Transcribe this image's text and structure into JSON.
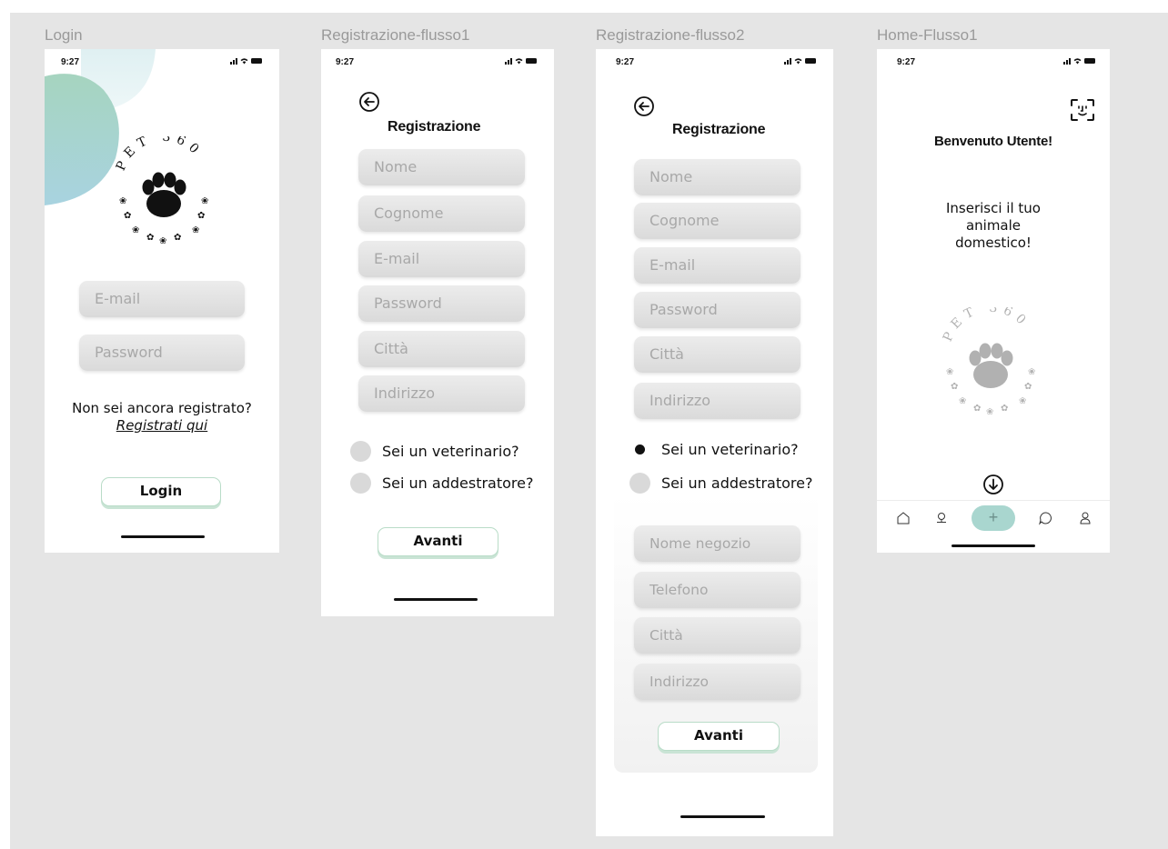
{
  "frames": {
    "login": {
      "label": "Login",
      "time": "9:27",
      "logo_text": "PET 360",
      "email_placeholder": "E-mail",
      "password_placeholder": "Password",
      "not_registered": "Non sei ancora registrato?",
      "register_link": "Registrati qui",
      "login_button": "Login"
    },
    "reg1": {
      "label": "Registrazione-flusso1",
      "time": "9:27",
      "title": "Registrazione",
      "fields": [
        "Nome",
        "Cognome",
        "E-mail",
        "Password",
        "Città",
        "Indirizzo"
      ],
      "vet_question": "Sei un veterinario?",
      "trainer_question": "Sei un addestratore?",
      "next_button": "Avanti"
    },
    "reg2": {
      "label": "Registrazione-flusso2",
      "time": "9:27",
      "title": "Registrazione",
      "fields": [
        "Nome",
        "Cognome",
        "E-mail",
        "Password",
        "Città",
        "Indirizzo"
      ],
      "vet_question": "Sei un veterinario?",
      "vet_checked": true,
      "trainer_question": "Sei un addestratore?",
      "shop_fields": [
        "Nome negozio",
        "Telefono",
        "Città",
        "Indirizzo"
      ],
      "next_button": "Avanti"
    },
    "home": {
      "label": "Home-Flusso1",
      "time": "9:27",
      "welcome": "Benvenuto Utente!",
      "prompt_line1": "Inserisci il tuo",
      "prompt_line2": "animale",
      "prompt_line3": "domestico!",
      "logo_text": "PET 360",
      "add_label": "+",
      "nav_icons": [
        "home-icon",
        "map-pin-icon",
        "add-button",
        "chat-icon",
        "profile-icon"
      ]
    }
  },
  "colors": {
    "canvas": "#e5e5e5",
    "accent_green": "#b9dcc8",
    "add_button": "#a9d6cf",
    "blob_green": "#a6d4bf",
    "blob_blue": "#a8d3e0"
  }
}
